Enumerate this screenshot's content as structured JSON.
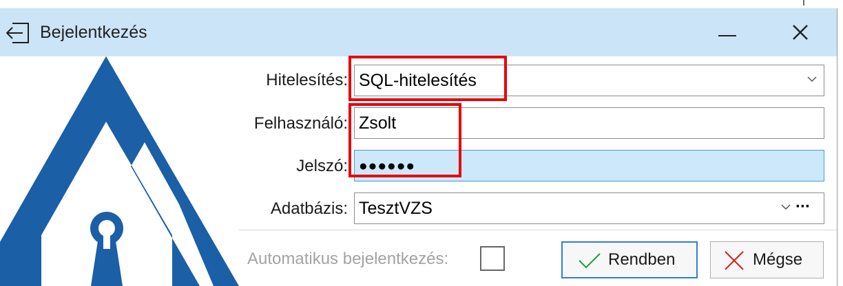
{
  "window": {
    "title": "Bejelentkezés",
    "accent_color": "#cce4f7",
    "logo_color": "#1b5fa6"
  },
  "icons": {
    "title": "sign-in-arrow-icon",
    "minimize": "minimize-icon",
    "close": "close-icon",
    "dropdown": "chevron-down-icon",
    "browse": "ellipsis-icon",
    "ok": "checkmark-icon",
    "cancel": "x-icon"
  },
  "form": {
    "auth_label": "Hitelesítés:",
    "auth_value": "SQL-hitelesítés",
    "user_label": "Felhasználó:",
    "user_value": "Zsolt",
    "password_label": "Jelszó:",
    "password_value": "●●●●●●",
    "database_label": "Adatbázis:",
    "database_value": "TesztVZS",
    "browse_label": "···",
    "auto_login_label": "Automatikus bejelentkezés:",
    "auto_login_checked": false
  },
  "buttons": {
    "ok_label": "Rendben",
    "cancel_label": "Mégse"
  },
  "annotation": {
    "highlight_color": "#e8000b"
  }
}
